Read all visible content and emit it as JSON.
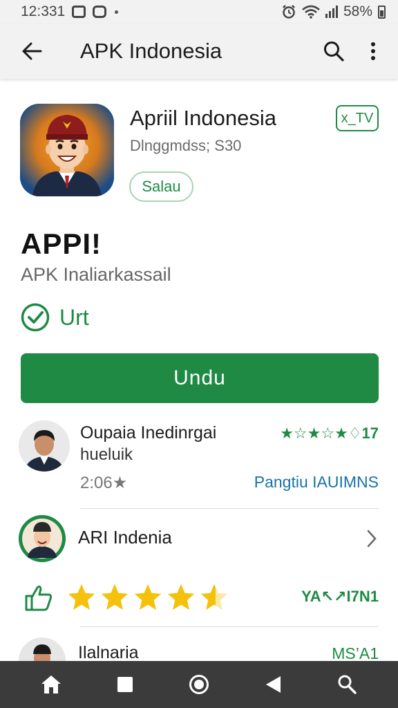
{
  "status_bar": {
    "time": "12:331",
    "battery_text": "58%"
  },
  "app_bar": {
    "title": "APK Indonesia",
    "back_icon": "arrow-back-icon",
    "search_icon": "search-icon",
    "more_icon": "more-vert-icon"
  },
  "app": {
    "name": "Apriil Indonesia",
    "developer": "Dlnggmdss; S30",
    "chip_label": "Salau",
    "age_badge": "x_TV",
    "big_title": "APPI!",
    "subtitle": "APK Inaliarkassail",
    "verified_label": "Urt",
    "install_label": "Undu"
  },
  "reviews": {
    "first": {
      "name": "Oupaia Inedinrgai",
      "sub": "hueluik",
      "count": "2:06",
      "stars_text": "★☆★☆★♢17",
      "link": "Pangtiu IAUIMNS"
    },
    "second": {
      "name": "ARI Indenia"
    },
    "rating_code": "YA↖↗I7N1",
    "third": {
      "name": "Ilalnaria",
      "code": "MS’A1"
    }
  },
  "colors": {
    "accent_green": "#1e8a44",
    "link_blue": "#1673a6",
    "star_yellow": "#f4c20d",
    "nav_bar": "#3b3b3b"
  }
}
